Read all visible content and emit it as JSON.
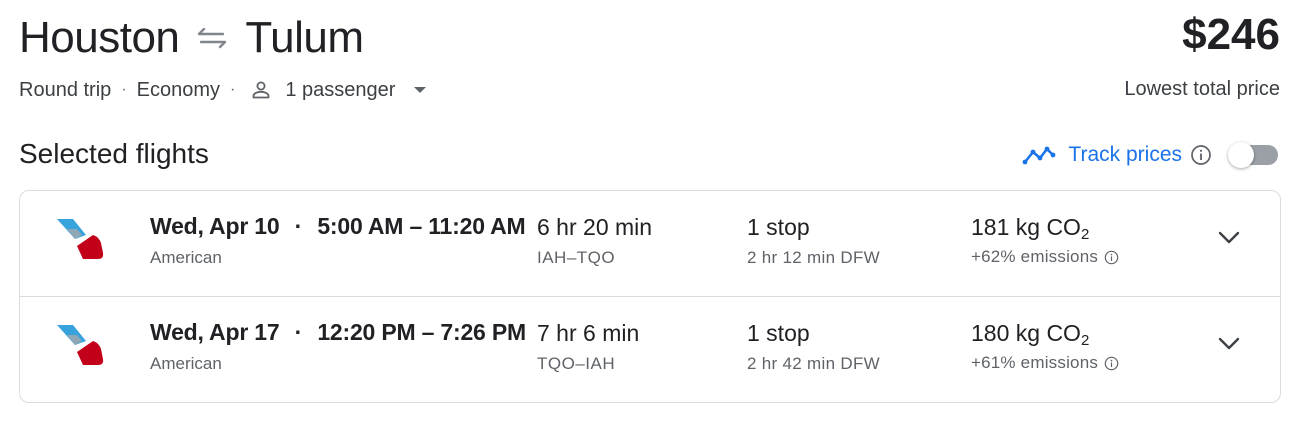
{
  "header": {
    "origin": "Houston",
    "destination": "Tulum",
    "swap_icon": "swap-arrows-icon"
  },
  "price": {
    "amount": "$246",
    "caption": "Lowest total price"
  },
  "trip_options": {
    "trip_type": "Round trip",
    "separator": "·",
    "cabin": "Economy",
    "passengers": "1 passenger"
  },
  "section": {
    "title": "Selected flights"
  },
  "track_prices": {
    "label": "Track prices",
    "enabled": false
  },
  "flights": [
    {
      "airline": "American",
      "date": "Wed, Apr 10",
      "time_range": "5:00 AM – 11:20 AM",
      "duration": "6 hr 20 min",
      "route": "IAH–TQO",
      "stops": "1 stop",
      "layover": "2 hr 12 min DFW",
      "co2_value": "181 kg CO",
      "co2_sub": "2",
      "emissions": "+62% emissions"
    },
    {
      "airline": "American",
      "date": "Wed, Apr 17",
      "time_range": "12:20 PM – 7:26 PM",
      "duration": "7 hr 6 min",
      "route": "TQO–IAH",
      "stops": "1 stop",
      "layover": "2 hr 42 min DFW",
      "co2_value": "180 kg CO",
      "co2_sub": "2",
      "emissions": "+61% emissions"
    }
  ],
  "colors": {
    "accent": "#1a73e8",
    "text": "#202124",
    "muted": "#5f6368",
    "border": "#dadce0",
    "airline_red": "#c30019",
    "airline_blue": "#36a3dd"
  }
}
